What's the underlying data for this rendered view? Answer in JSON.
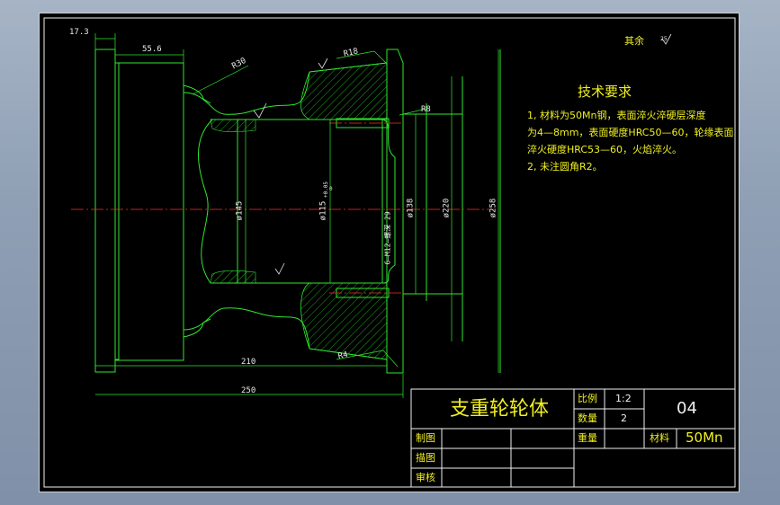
{
  "drawing": {
    "dimensions": {
      "d_17_3": "17.3",
      "d_55_6": "55.6",
      "d_R30": "R30",
      "d_R18": "R18",
      "d_R8": "R8",
      "d_R4": "R4",
      "d_145": "ø145",
      "d_115": "ø115",
      "d_115_tol_up": "+0.05",
      "d_115_tol_low": "0",
      "d_tapped": "6—M12—螺深 29",
      "d_138": "ø138",
      "d_220": "ø220",
      "d_258": "ø258",
      "d_210": "210",
      "d_250": "250"
    },
    "roughness": {
      "top_right": "其余",
      "symbol_value": "25"
    },
    "tech_requirements": {
      "title": "技术要求",
      "line1": "1, 材料为50Mn钢，表面淬火淬硬层深度",
      "line2": "为4—8mm，表面硬度HRC50—60，轮缘表面",
      "line3": "淬火硬度HRC53—60，火焰淬火。",
      "line4": "2, 未注圆角R2。"
    }
  },
  "title_block": {
    "part_name": "支重轮轮体",
    "scale_label": "比例",
    "scale_value": "1:2",
    "qty_label": "数量",
    "qty_value": "2",
    "weight_label": "重量",
    "material_label": "材料",
    "material_value": "50Mn",
    "drawing_no": "04",
    "drawn_label": "制图",
    "traced_label": "描图",
    "checked_label": "审核"
  },
  "colors": {
    "background": "#000000",
    "outline": "#2ee82e",
    "centerline": "#ff2a2a",
    "text": "#f0f020",
    "dim_text": "#eaeaea",
    "window": "#8f9fb4"
  }
}
